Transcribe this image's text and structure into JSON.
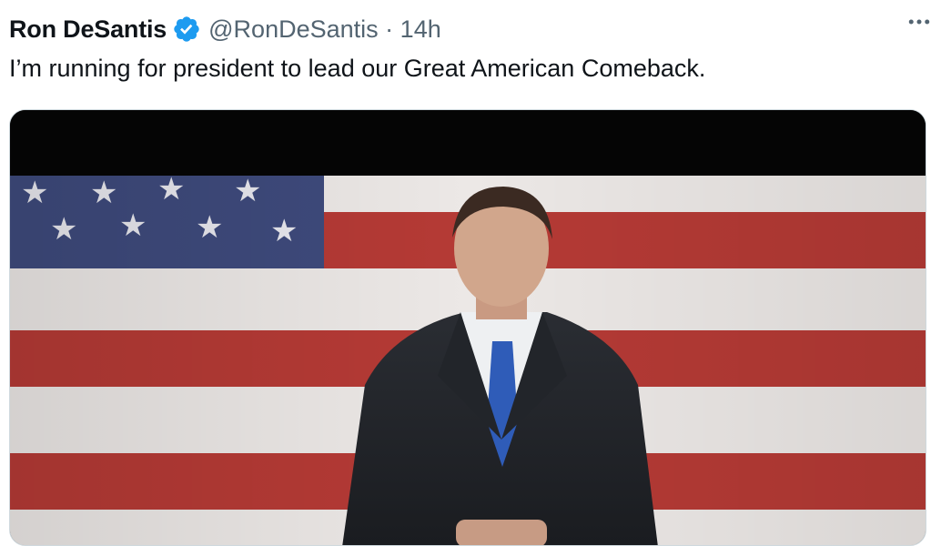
{
  "tweet": {
    "author": {
      "display_name": "Ron DeSantis",
      "handle": "@RonDeSantis",
      "verified": true,
      "verified_icon": "verified-badge-icon"
    },
    "separator": "·",
    "timestamp": "14h",
    "text": "I’m running for president to lead our Great American Comeback.",
    "more_icon": "more-horizontal-icon",
    "media": {
      "type": "video",
      "description_icon": "video-thumbnail"
    }
  },
  "colors": {
    "text_primary": "#0f1419",
    "text_secondary": "#536471",
    "verified_blue": "#1d9bf0",
    "border": "#cfd9de",
    "flag_red": "#b53a35",
    "flag_white": "#ece8e6",
    "flag_blue": "#3e4a7c"
  }
}
